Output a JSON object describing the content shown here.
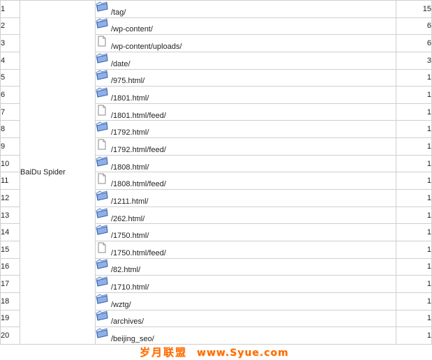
{
  "table": {
    "agent": "BaiDu Spider",
    "rows": [
      {
        "idx": "1",
        "path": "/tag/",
        "icon": "folder-icon",
        "count": "15"
      },
      {
        "idx": "2",
        "path": "/wp-content/",
        "icon": "folder-icon",
        "count": "6"
      },
      {
        "idx": "3",
        "path": "/wp-content/uploads/",
        "icon": "file-icon",
        "count": "6"
      },
      {
        "idx": "4",
        "path": "/date/",
        "icon": "folder-icon",
        "count": "3"
      },
      {
        "idx": "5",
        "path": "/975.html/",
        "icon": "folder-icon",
        "count": "1"
      },
      {
        "idx": "6",
        "path": "/1801.html/",
        "icon": "folder-icon",
        "count": "1"
      },
      {
        "idx": "7",
        "path": "/1801.html/feed/",
        "icon": "file-icon",
        "count": "1"
      },
      {
        "idx": "8",
        "path": "/1792.html/",
        "icon": "folder-icon",
        "count": "1"
      },
      {
        "idx": "9",
        "path": "/1792.html/feed/",
        "icon": "file-icon",
        "count": "1"
      },
      {
        "idx": "10",
        "path": "/1808.html/",
        "icon": "folder-icon",
        "count": "1"
      },
      {
        "idx": "11",
        "path": "/1808.html/feed/",
        "icon": "file-icon",
        "count": "1"
      },
      {
        "idx": "12",
        "path": "/1211.html/",
        "icon": "folder-icon",
        "count": "1"
      },
      {
        "idx": "13",
        "path": "/262.html/",
        "icon": "folder-icon",
        "count": "1"
      },
      {
        "idx": "14",
        "path": "/1750.html/",
        "icon": "folder-icon",
        "count": "1"
      },
      {
        "idx": "15",
        "path": "/1750.html/feed/",
        "icon": "file-icon",
        "count": "1"
      },
      {
        "idx": "16",
        "path": "/82.html/",
        "icon": "folder-icon",
        "count": "1"
      },
      {
        "idx": "17",
        "path": "/1710.html/",
        "icon": "folder-icon",
        "count": "1"
      },
      {
        "idx": "18",
        "path": "/wztg/",
        "icon": "folder-icon",
        "count": "1"
      },
      {
        "idx": "19",
        "path": "/archives/",
        "icon": "folder-icon",
        "count": "1"
      },
      {
        "idx": "20",
        "path": "/beijing_seo/",
        "icon": "folder-icon",
        "count": "1"
      }
    ]
  },
  "watermark": {
    "cn": "岁月联盟",
    "url": "www.Syue.com"
  },
  "colors": {
    "border": "#cfcfcf",
    "folder_blue": "#5b82c8",
    "watermark": "#ff6a00"
  }
}
